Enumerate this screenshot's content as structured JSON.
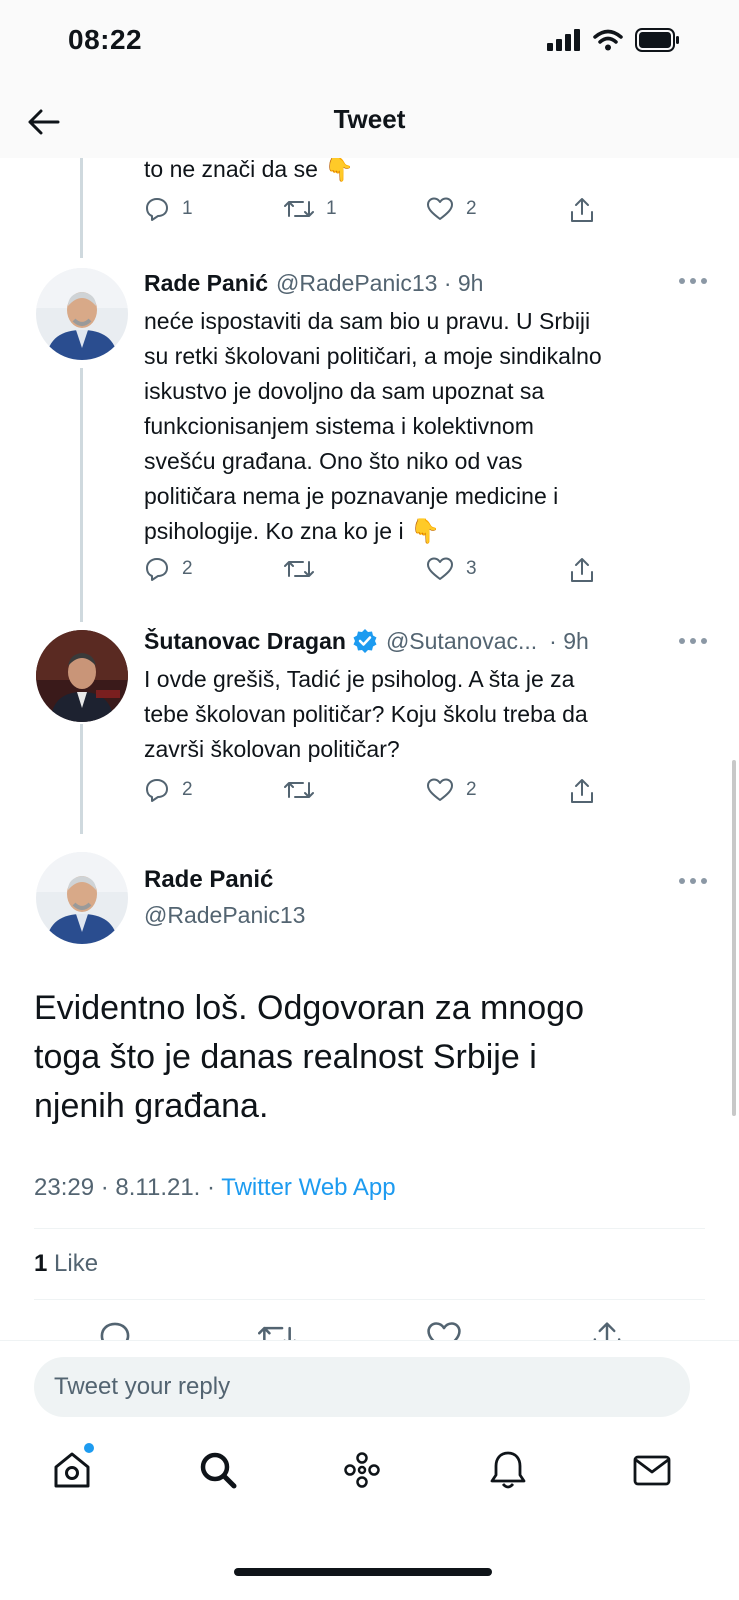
{
  "status_bar": {
    "time": "08:22"
  },
  "header": {
    "title": "Tweet"
  },
  "thread": {
    "partial_tweet": {
      "text": "to ne znači da se ",
      "emoji": "👇",
      "replies": "1",
      "retweets": "1",
      "likes": "2"
    },
    "reply1": {
      "name": "Rade Panić",
      "handle": "@RadePanic13 · 9h",
      "lines": [
        "neće ispostaviti da sam bio u pravu. U Srbiji",
        "su retki školovani političari, a moje sindikalno",
        "iskustvo je dovoljno da sam upoznat sa",
        "funkcionisanjem sistema i kolektivnom",
        "svešću građana. Ono što niko od vas",
        "političara nema je poznavanje medicine i",
        "psihologije. Ko zna ko je i "
      ],
      "emoji": "👇",
      "replies": "2",
      "retweets": "",
      "likes": "3"
    },
    "reply2": {
      "name": "Šutanovac Dragan",
      "handle": "@Sutanovac...",
      "time": "· 9h",
      "lines": [
        "I ovde grešiš, Tadić je psiholog. A šta je za",
        "tebe školovan političar? Koju školu treba da",
        "završi školovan političar?"
      ],
      "replies": "2",
      "retweets": "",
      "likes": "2"
    }
  },
  "main_tweet": {
    "name": "Rade Panić",
    "handle": "@RadePanic13",
    "lines": [
      "Evidentno loš. Odgovoran za mnogo",
      "toga što je danas realnost Srbije i",
      "njenih građana."
    ],
    "timestamp": "23:29 · 8.11.21. · ",
    "source": "Twitter Web App",
    "like_count": "1",
    "like_label": " Like"
  },
  "reply_bar": {
    "placeholder": "Tweet your reply"
  },
  "tab_bar": {
    "items": [
      "home-icon",
      "search-icon",
      "spaces-icon",
      "notifications-icon",
      "messages-icon"
    ]
  },
  "colors": {
    "accent": "#1d9bf0",
    "text": "#0f1419",
    "secondary": "#536471",
    "divider": "#eff3f4"
  }
}
